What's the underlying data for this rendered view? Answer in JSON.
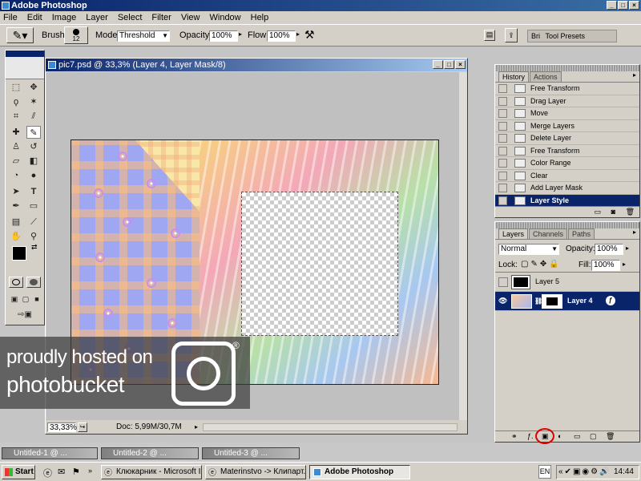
{
  "app": {
    "title": "Adobe Photoshop"
  },
  "menu": [
    "File",
    "Edit",
    "Image",
    "Layer",
    "Select",
    "Filter",
    "View",
    "Window",
    "Help"
  ],
  "options": {
    "brush_label": "Brush:",
    "brush_size": "12",
    "mode_label": "Mode:",
    "mode_value": "Threshold",
    "opacity_label": "Opacity:",
    "opacity_value": "100%",
    "flow_label": "Flow:",
    "flow_value": "100%",
    "tool_presets": "Tool Presets",
    "bri": "Bri"
  },
  "document": {
    "title": "pic7.psd @ 33,3% (Layer 4, Layer Mask/8)",
    "zoom": "33,33%",
    "doc_info": "Doc: 5,99M/30,7M"
  },
  "history": {
    "tabs": [
      "History",
      "Actions"
    ],
    "items": [
      "Free Transform",
      "Drag Layer",
      "Move",
      "Merge Layers",
      "Delete Layer",
      "Free Transform",
      "Color Range",
      "Clear",
      "Add Layer Mask",
      "Layer Style"
    ]
  },
  "layers": {
    "tabs": [
      "Layers",
      "Channels",
      "Paths"
    ],
    "blend_mode": "Normal",
    "opacity_label": "Opacity:",
    "opacity_value": "100%",
    "lock_label": "Lock:",
    "fill_label": "Fill:",
    "fill_value": "100%",
    "items": [
      {
        "name": "Layer 5"
      },
      {
        "name": "Layer 4"
      }
    ]
  },
  "watermark": {
    "line1": "proudly hosted on",
    "line2": "photobucket",
    "reg": "®"
  },
  "minimized_windows": [
    "Untitled-1 @ ...",
    "Untitled-2 @ ...",
    "Untitled-3 @ ..."
  ],
  "taskbar": {
    "start": "Start",
    "buttons": [
      "Клюкарник - Microsoft I...",
      "Materinstvo -> Клипарт...",
      "Adobe Photoshop"
    ],
    "lang": "EN",
    "clock": "14:44"
  },
  "colors": {
    "title_blue": "#0a246a",
    "selection_blue": "#0a246a",
    "annotation_red": "#e00000"
  }
}
